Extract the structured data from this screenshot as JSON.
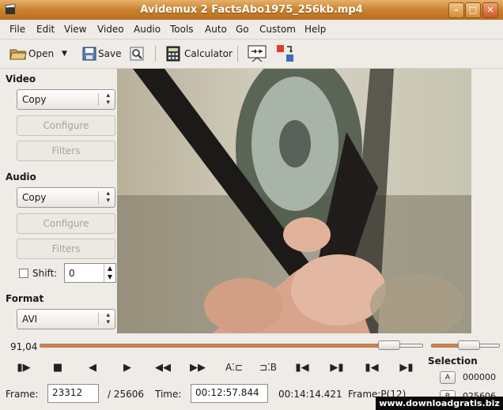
{
  "window": {
    "title": "Avidemux 2 FactsAbo1975_256kb.mp4"
  },
  "menu": [
    "File",
    "Edit",
    "View",
    "Video",
    "Audio",
    "Tools",
    "Auto",
    "Go",
    "Custom",
    "Help"
  ],
  "menu_underline": [
    "F",
    "E",
    "V",
    "V",
    "A",
    "T",
    "A",
    "G",
    "C",
    "H"
  ],
  "toolbar": {
    "open": "Open",
    "save": "Save",
    "calculator": "Calculator"
  },
  "video_section": {
    "label": "Video",
    "codec": "Copy",
    "configure": "Configure",
    "filters": "Filters"
  },
  "audio_section": {
    "label": "Audio",
    "codec": "Copy",
    "configure": "Configure",
    "filters": "Filters",
    "shift_label": "Shift:",
    "shift_value": "0"
  },
  "format_section": {
    "label": "Format",
    "container": "AVI"
  },
  "seek": {
    "value_label": "91,04",
    "position_fraction": 0.9104,
    "volume_fraction": 0.55
  },
  "selection": {
    "label": "Selection",
    "a_button": "A",
    "a_value": "000000",
    "b_button": "B",
    "b_value": "025606"
  },
  "status": {
    "frame_label": "Frame:",
    "frame_value": "23312",
    "frame_total": "/ 25606",
    "time_label": "Time:",
    "time_value": "00:12:57.844",
    "duration": "00:14:14.421",
    "frame_type": "Frame:P(12)"
  },
  "watermark": "www.downloadgratis.biz"
}
